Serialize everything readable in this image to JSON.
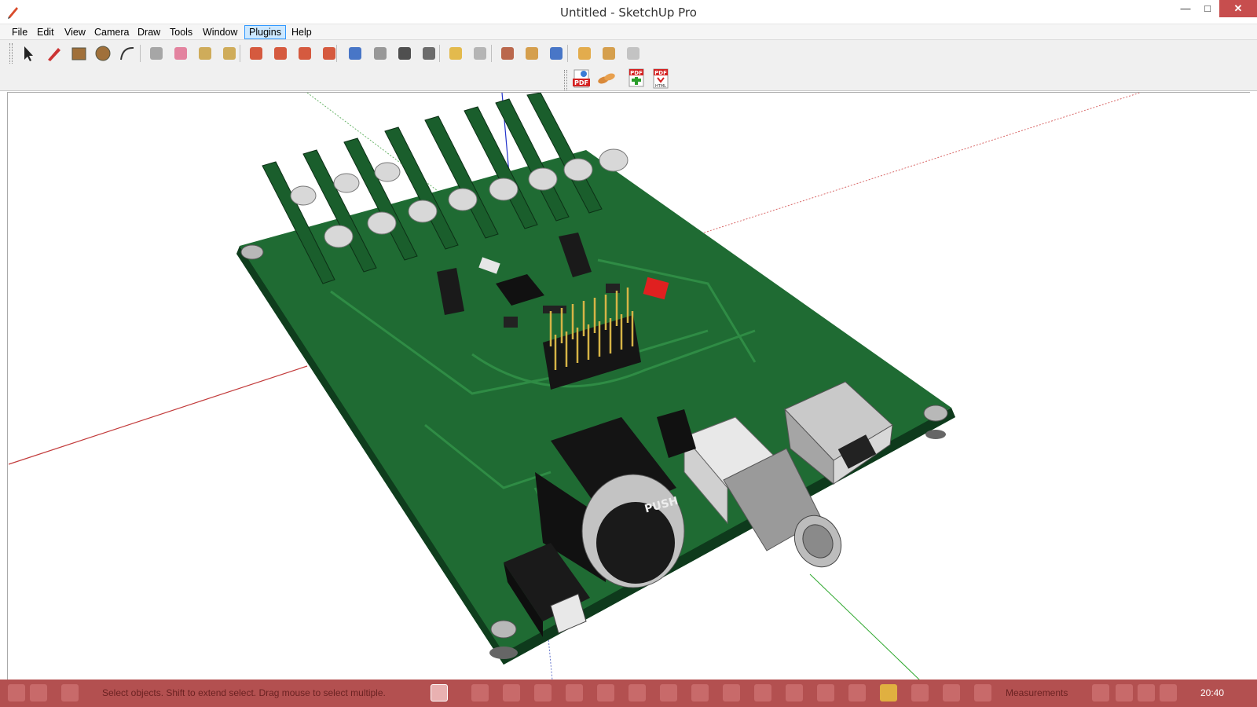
{
  "window": {
    "title": "Untitled - SketchUp Pro",
    "minimize_label": "—",
    "maximize_label": "□",
    "close_label": "✕"
  },
  "menu": {
    "items": [
      {
        "label": "File"
      },
      {
        "label": "Edit"
      },
      {
        "label": "View"
      },
      {
        "label": "Camera"
      },
      {
        "label": "Draw"
      },
      {
        "label": "Tools"
      },
      {
        "label": "Window"
      },
      {
        "label": "Plugins",
        "active": true
      },
      {
        "label": "Help"
      }
    ]
  },
  "toolbar": {
    "tools": [
      "select-tool",
      "pencil-tool",
      "rectangle-tool",
      "circle-tool",
      "arc-tool",
      "make-component-tool",
      "eraser-tool",
      "tape-measure-tool",
      "paint-bucket-tool",
      "push-pull-tool",
      "move-tool",
      "rotate-tool",
      "offset-tool",
      "orbit-tool",
      "pan-tool",
      "zoom-tool",
      "zoom-extents-tool",
      "previous-view-tool",
      "next-view-tool",
      "position-camera-tool",
      "walk-tool",
      "look-around-tool",
      "get-models-tool",
      "share-model-tool",
      "extension-warehouse-tool"
    ],
    "plugins": [
      "export-pdf-plugin",
      "link-plugin",
      "pdf-add-plugin",
      "pdf-html-plugin"
    ]
  },
  "model": {
    "connector_label": "PUSH",
    "board_color": "#1f6b33",
    "axis_red": "#cc3333",
    "axis_green": "#2fa82f",
    "axis_blue": "#2233cc"
  },
  "statusbar": {
    "hint": "Select objects. Shift to extend select. Drag mouse to select multiple.",
    "measurements": "Measurements",
    "time": "20:40"
  }
}
